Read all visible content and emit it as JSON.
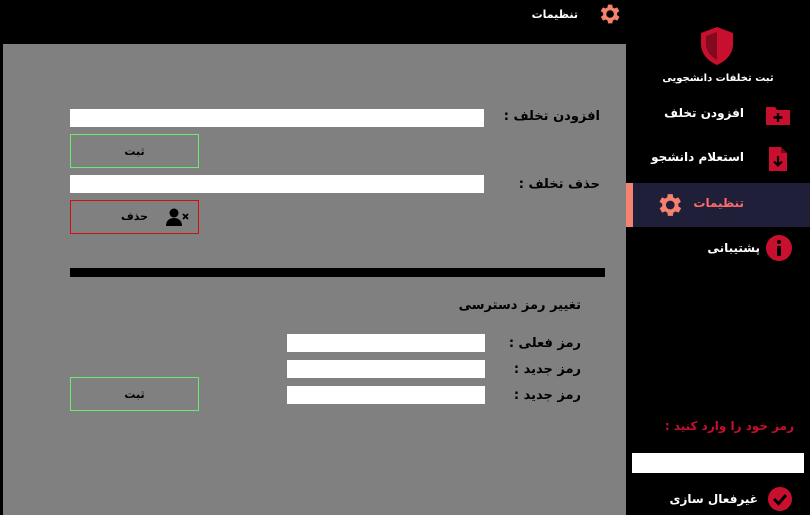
{
  "window": {
    "title": "تنظیمات",
    "close_glyph": "✕"
  },
  "sidebar": {
    "app_title": "ثبت تخلفات دانشجویی",
    "items": [
      {
        "label": "افزودن تخلف",
        "icon": "folder-plus-icon"
      },
      {
        "label": "استعلام دانشجو",
        "icon": "file-download-icon"
      },
      {
        "label": "تنظیمات",
        "icon": "gear-icon",
        "active": true
      },
      {
        "label": "پشتیبانی",
        "icon": "info-icon"
      }
    ],
    "password_prompt": "رمز خود را وارد کنید :",
    "password_value": "",
    "deactivate_label": "غیرفعال سازی"
  },
  "main": {
    "add_violation": {
      "label": "افزودن تخلف :",
      "value": "",
      "submit_label": "ثبت"
    },
    "delete_violation": {
      "label": "حذف تخلف :",
      "value": "",
      "delete_label": "حذف"
    },
    "change_password": {
      "heading": "تغییر رمز دسترسی",
      "current_label": "رمز فعلی :",
      "new_label": "رمز جدید :",
      "confirm_label": "رمز جدید :",
      "current_value": "",
      "new_value": "",
      "confirm_value": "",
      "submit_label": "ثبت"
    }
  },
  "colors": {
    "accent_red": "#c8102e",
    "panel_gray": "#808080",
    "active_bg": "#1f1f3a",
    "active_text": "#ff6b6b",
    "active_bar": "#f4826e",
    "green_border": "#6ee86e"
  }
}
